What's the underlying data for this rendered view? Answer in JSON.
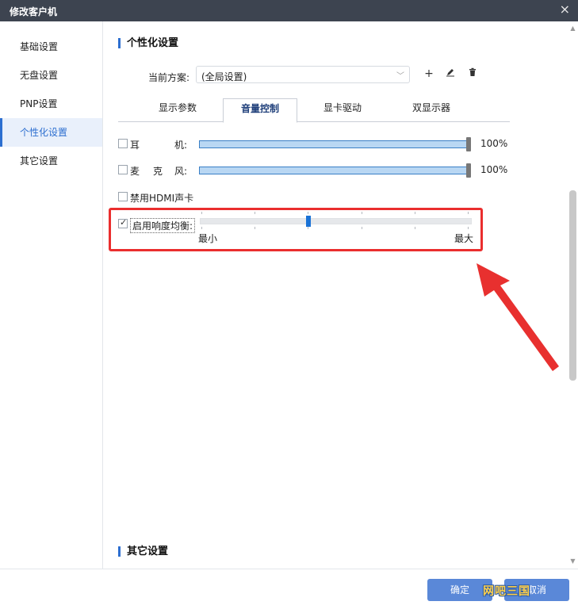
{
  "window": {
    "title": "修改客户机",
    "close_icon": "×"
  },
  "sidebar": {
    "items": [
      {
        "label": "基础设置",
        "active": false
      },
      {
        "label": "无盘设置",
        "active": false
      },
      {
        "label": "PNP设置",
        "active": false
      },
      {
        "label": "个性化设置",
        "active": true
      },
      {
        "label": "其它设置",
        "active": false
      }
    ]
  },
  "personalization": {
    "section_title": "个性化设置",
    "scheme_label": "当前方案:",
    "scheme_value": "(全局设置)",
    "tabs": [
      {
        "label": "显示参数",
        "active": false
      },
      {
        "label": "音量控制",
        "active": true
      },
      {
        "label": "显卡驱动",
        "active": false
      },
      {
        "label": "双显示器",
        "active": false
      }
    ]
  },
  "volume": {
    "headphone": {
      "label_a": "耳",
      "label_b": "机:",
      "checked": false,
      "value_text": "100%",
      "level": 1.0
    },
    "microphone": {
      "label_a": "麦",
      "label_b": "克",
      "label_c": "风:",
      "checked": false,
      "value_text": "100%",
      "level": 1.0
    },
    "disable_hdmi": {
      "label": "禁用HDMI声卡",
      "checked": false
    },
    "loudness": {
      "label": "启用响度均衡:",
      "checked": true,
      "min_label": "最小",
      "max_label": "最大",
      "level": 0.4
    }
  },
  "other_section_title": "其它设置",
  "footer": {
    "ok_label": "确定",
    "cancel_label": "取消"
  },
  "watermark": "网吧三国",
  "colors": {
    "accent": "#2d6fd0",
    "highlight": "#ea2e2e",
    "titlebar": "#3d4450"
  }
}
